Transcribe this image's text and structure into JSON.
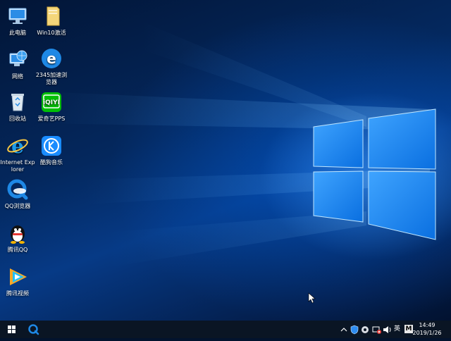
{
  "desktop": {
    "icons": [
      {
        "label": "此电脑"
      },
      {
        "label": "Win10激活"
      },
      {
        "label": "网络"
      },
      {
        "label": "2345加速浏览器"
      },
      {
        "label": "回收站"
      },
      {
        "label": "爱奇艺PPS"
      },
      {
        "label": "Internet Explorer"
      },
      {
        "label": "酷狗音乐"
      },
      {
        "label": "QQ浏览器"
      },
      {
        "label": "腾讯QQ"
      },
      {
        "label": "腾讯视频"
      }
    ]
  },
  "taskbar": {
    "tray": {
      "ime_label": "英",
      "ime_mode": "M"
    },
    "clock": {
      "time": "14:49",
      "date": "2019/1/26"
    }
  },
  "colors": {
    "taskbar": "#0a1524",
    "accent": "#1e88e5"
  }
}
